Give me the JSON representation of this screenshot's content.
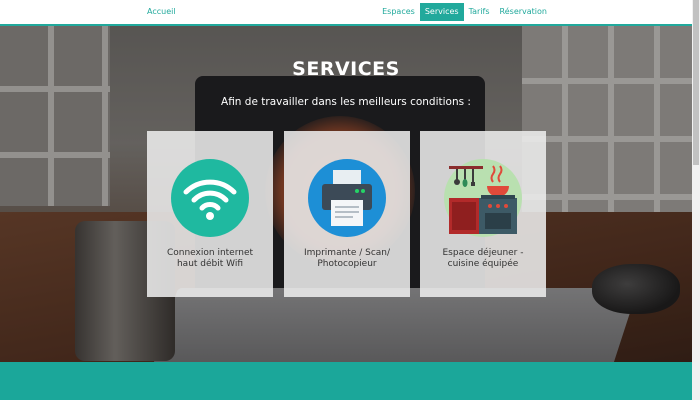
{
  "nav": {
    "brand": "Accueil",
    "items": [
      {
        "label": "Espaces",
        "active": false
      },
      {
        "label": "Services",
        "active": true
      },
      {
        "label": "Tarifs",
        "active": false
      },
      {
        "label": "Réservation",
        "active": false
      }
    ]
  },
  "services": {
    "title": "SERVICES",
    "subtitle": "Afin de travailler dans les meilleurs conditions :",
    "cards": [
      {
        "icon": "wifi-icon",
        "line1": "Connexion internet",
        "line2": "haut débit Wifi"
      },
      {
        "icon": "printer-icon",
        "line1": "Imprimante / Scan/",
        "line2": "Photocopieur"
      },
      {
        "icon": "kitchen-icon",
        "line1": "Espace déjeuner -",
        "line2": "cuisine équipée"
      }
    ]
  },
  "colors": {
    "accent": "#21a99c",
    "footer": "#1ba79a",
    "wifi_circle": "#1fb9a0",
    "printer_circle": "#1d8fd6",
    "kitchen_circle": "#b9e0b0"
  }
}
